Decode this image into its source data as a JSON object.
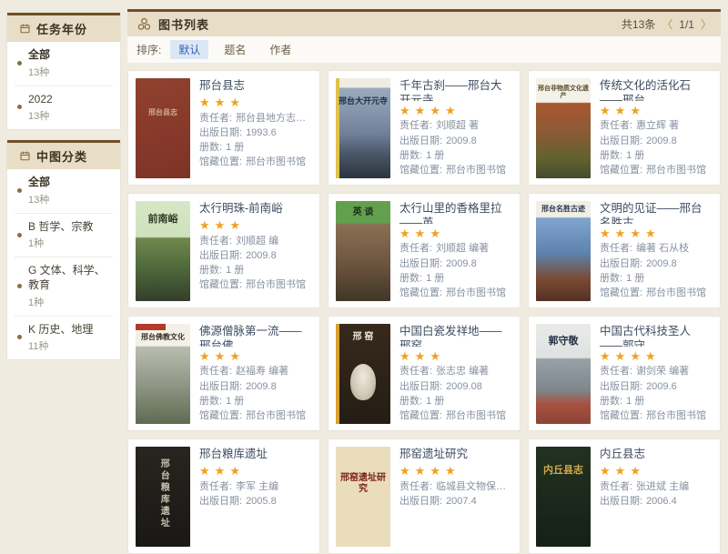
{
  "colors": {
    "page_bg": "#f0ebe0",
    "accent_brown": "#6e4f28",
    "icon_brown": "#8a6a3a",
    "panel_header_bg": "#e8ddc7",
    "star": "#f0a11d",
    "sort_active": "#2f62b8",
    "sort_active_bg": "#dce7f5",
    "pager_arrow": "#b5954f"
  },
  "sidebar": {
    "panels": [
      {
        "title": "任务年份",
        "icon": "calendar-icon",
        "items": [
          {
            "label": "全部",
            "count": "13种",
            "bold": true
          },
          {
            "label": "2022",
            "count": "13种"
          }
        ]
      },
      {
        "title": "中图分类",
        "icon": "calendar-icon",
        "items": [
          {
            "label": "全部",
            "count": "13种",
            "bold": true
          },
          {
            "label": "B 哲学、宗教",
            "count": "1种"
          },
          {
            "label": "G 文体、科学、教育",
            "count": "1种"
          },
          {
            "label": "K 历史、地理",
            "count": "11种"
          }
        ]
      }
    ]
  },
  "header": {
    "icon": "three-rings-icon",
    "title": "图书列表",
    "total": "共13条",
    "prev": "〈",
    "page": "1/1",
    "next": "〉"
  },
  "sort": {
    "label": "排序:",
    "options": [
      {
        "label": "默认",
        "active": true
      },
      {
        "label": "题名",
        "active": false
      },
      {
        "label": "作者",
        "active": false
      }
    ]
  },
  "books": [
    {
      "title": "邢台县志",
      "rating": 3,
      "fields": [
        {
          "label": "责任者:",
          "value": "邢台县地方志编纂委..."
        },
        {
          "label": "出版日期:",
          "value": "1993.6"
        },
        {
          "label": "册数:",
          "value": "1 册"
        },
        {
          "label": "馆藏位置:",
          "value": "邢台市图书馆"
        }
      ],
      "cover": {
        "bg": "linear-gradient(165deg,#91412f 0%,#7e3326 100%)",
        "text": "邢台县志",
        "textColor": "#cfa98f",
        "top": "30%",
        "fontSize": "8px"
      }
    },
    {
      "title": "千年古刹——邢台大开元寺",
      "rating": 4,
      "fields": [
        {
          "label": "责任者:",
          "value": "刘顺超 著"
        },
        {
          "label": "出版日期:",
          "value": "2009.8"
        },
        {
          "label": "册数:",
          "value": "1 册"
        },
        {
          "label": "馆藏位置:",
          "value": "邢台市图书馆"
        }
      ],
      "cover": {
        "bg": "linear-gradient(180deg,#efece1 0%,#efece1 9%,#9aabbe 10%,#72819a 55%,#4a5666 76%,#2b343f 100%)",
        "text": "邢台大开元寺",
        "textColor": "#223049",
        "top": "18%",
        "spine": "#e0c24a"
      }
    },
    {
      "title": "传统文化的活化石——邢台...",
      "rating": 3,
      "fields": [
        {
          "label": "责任者:",
          "value": "惠立辉 著"
        },
        {
          "label": "出版日期:",
          "value": "2009.8"
        },
        {
          "label": "册数:",
          "value": "1 册"
        },
        {
          "label": "馆藏位置:",
          "value": "邢台市图书馆"
        }
      ],
      "cover": {
        "bg": "linear-gradient(180deg,#f4f1e8 0%,#f4f1e8 24%,#a9572f 25%,#8a5a35 55%,#62622f 80%,#424c2c 100%)",
        "text": "邢台非物质文化遗产",
        "textColor": "#584a28",
        "top": "7%",
        "fontSize": "7px"
      }
    },
    {
      "title": "太行明珠-前南峪",
      "rating": 3,
      "fields": [
        {
          "label": "责任者:",
          "value": "刘顺超 编"
        },
        {
          "label": "出版日期:",
          "value": "2009.8"
        },
        {
          "label": "册数:",
          "value": "1 册"
        },
        {
          "label": "馆藏位置:",
          "value": "邢台市图书馆"
        }
      ],
      "cover": {
        "bg": "linear-gradient(180deg,#d7e7c6 0%,#cde1bb 36%,#6f894e 37%,#4a6238 72%,#343f2b 100%)",
        "text": "前南峪",
        "textColor": "#2e3a26",
        "top": "13%",
        "fontSize": "11px"
      }
    },
    {
      "title": "太行山里的香格里拉——英...",
      "rating": 3,
      "fields": [
        {
          "label": "责任者:",
          "value": "刘顺超 编著"
        },
        {
          "label": "出版日期:",
          "value": "2009.8"
        },
        {
          "label": "册数:",
          "value": "1 册"
        },
        {
          "label": "馆藏位置:",
          "value": "邢台市图书馆"
        }
      ],
      "cover": {
        "bg": "linear-gradient(180deg,#62a04e 0%,#62a04e 22%,#8a7154 23%,#6f5741 60%,#413627 100%)",
        "text": "英 谈",
        "textColor": "#20301b",
        "top": "6%",
        "fontSize": "10px"
      }
    },
    {
      "title": "文明的见证——邢台名胜古...",
      "rating": 4,
      "fields": [
        {
          "label": "责任者:",
          "value": "编著 石从枝"
        },
        {
          "label": "出版日期:",
          "value": "2009.8"
        },
        {
          "label": "册数:",
          "value": "1 册"
        },
        {
          "label": "馆藏位置:",
          "value": "邢台市图书馆"
        }
      ],
      "cover": {
        "bg": "linear-gradient(180deg,#f1eee4 0%,#f1eee4 16%,#80a4ce 17%,#5d83ae 52%,#7a4a33 78%,#523125 100%)",
        "text": "邢台名胜古迹",
        "textColor": "#2c3c58",
        "top": "4%",
        "fontSize": "8px"
      }
    },
    {
      "title": "佛源僧脉第一流——邢台佛...",
      "rating": 3,
      "fields": [
        {
          "label": "责任者:",
          "value": "赵福寿 编著"
        },
        {
          "label": "出版日期:",
          "value": "2009.8"
        },
        {
          "label": "册数:",
          "value": "1 册"
        },
        {
          "label": "馆藏位置:",
          "value": "邢台市图书馆"
        }
      ],
      "cover": {
        "bg": "linear-gradient(180deg,#f3f0e7 0%,#f3f0e7 22%,#b9bdb0 23%,#8f9584 62%,#5e6a51 100%)",
        "band": "#b23a28",
        "text": "邢台佛教文化",
        "textColor": "#3a332a",
        "top": "9%",
        "fontSize": "8px"
      }
    },
    {
      "title": "中国白瓷发祥地——邢窑",
      "rating": 3,
      "fields": [
        {
          "label": "责任者:",
          "value": "张志忠 编著"
        },
        {
          "label": "出版日期:",
          "value": "2009.08"
        },
        {
          "label": "册数:",
          "value": "1 册"
        },
        {
          "label": "馆藏位置:",
          "value": "邢台市图书馆"
        }
      ],
      "cover": {
        "bg": "linear-gradient(180deg,#37291c 0%,#241d14 100%)",
        "spine": "#d8a030",
        "spot": "radial-gradient(ellipse at 50% 35%, #efeade 0%, #cfc7b4 60%, #9a917d 100%)",
        "text": "邢 窑",
        "textColor": "#e9e3d3",
        "top": "8%",
        "fontSize": "10px"
      }
    },
    {
      "title": "中国古代科技圣人——郭守...",
      "rating": 4,
      "fields": [
        {
          "label": "责任者:",
          "value": "谢剑荣 编著"
        },
        {
          "label": "出版日期:",
          "value": "2009.6"
        },
        {
          "label": "册数:",
          "value": "1 册"
        },
        {
          "label": "馆藏位置:",
          "value": "邢台市图书馆"
        }
      ],
      "cover": {
        "bg": "linear-gradient(180deg,#e9ebe8 0%,#dde2e1 34%,#98a1a6 35%,#7d878d 66%,#a65242 80%,#8d4335 100%)",
        "text": "郭守敬",
        "textColor": "#233044",
        "top": "12%",
        "fontSize": "11px"
      }
    },
    {
      "title": "邢台粮库遗址",
      "rating": 3,
      "fields": [
        {
          "label": "责任者:",
          "value": "李军 主编"
        },
        {
          "label": "出版日期:",
          "value": "2005.8"
        }
      ],
      "cover": {
        "bg": "linear-gradient(180deg,#282520 0%,#1a1815 100%)",
        "text": "邢台粮库遗址",
        "textColor": "#c7c0af",
        "vertical": true,
        "fontSize": "10px"
      }
    },
    {
      "title": "邢窑遗址研究",
      "rating": 4,
      "fields": [
        {
          "label": "责任者:",
          "value": "临城县文物保管所 ..."
        },
        {
          "label": "出版日期:",
          "value": "2007.4"
        }
      ],
      "cover": {
        "bg": "#e9ddba",
        "text": "邢窑遗址研究",
        "textColor": "#7c241a",
        "top": "26%",
        "fontSize": "10px"
      }
    },
    {
      "title": "内丘县志",
      "rating": 3,
      "fields": [
        {
          "label": "责任者:",
          "value": "张进斌 主编"
        },
        {
          "label": "出版日期:",
          "value": "2006.4"
        }
      ],
      "cover": {
        "bg": "linear-gradient(180deg,#223121 0%,#162016 100%)",
        "text": "内丘县志",
        "textColor": "#d3ab46",
        "top": "18%",
        "fontSize": "11px"
      }
    }
  ]
}
